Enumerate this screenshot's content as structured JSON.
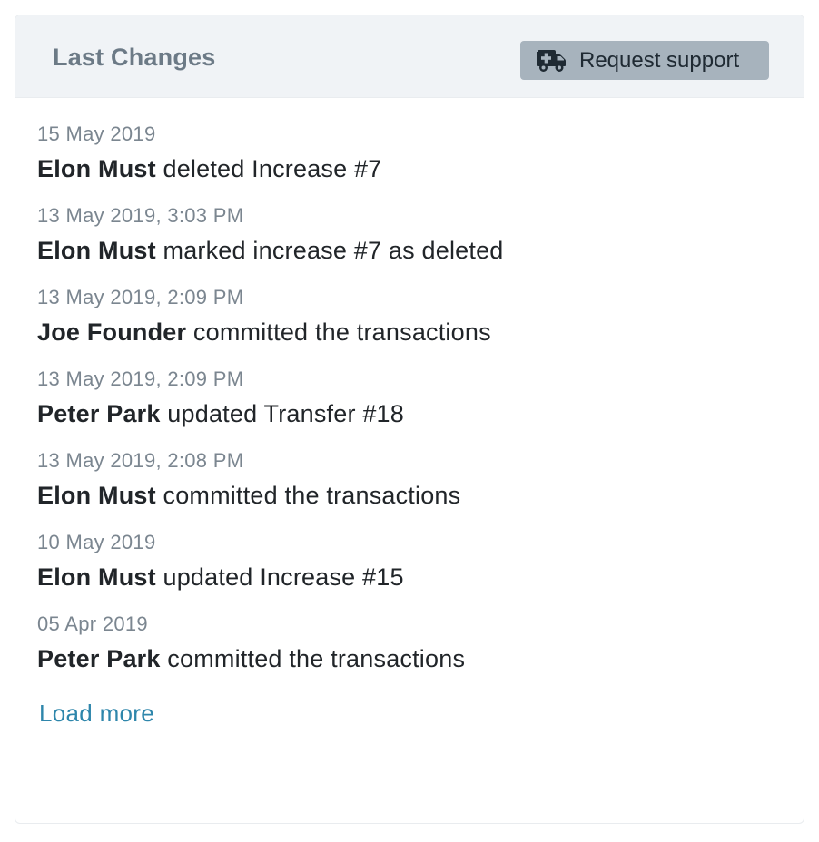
{
  "card": {
    "title": "Last Changes",
    "support_button": {
      "label": "Request support",
      "icon": "ambulance-icon"
    }
  },
  "changes": [
    {
      "date": "15 May 2019",
      "actor": "Elon Must",
      "action": "deleted Increase #7"
    },
    {
      "date": "13 May 2019, 3:03 PM",
      "actor": "Elon Must",
      "action": "marked increase #7 as deleted"
    },
    {
      "date": "13 May 2019, 2:09 PM",
      "actor": "Joe Founder",
      "action": "committed the transactions"
    },
    {
      "date": "13 May 2019, 2:09 PM",
      "actor": "Peter Park",
      "action": "updated Transfer #18"
    },
    {
      "date": "13 May 2019, 2:08 PM",
      "actor": "Elon Must",
      "action": "committed the transactions"
    },
    {
      "date": "10 May 2019",
      "actor": "Elon Must",
      "action": "updated Increase #15"
    },
    {
      "date": "05 Apr 2019",
      "actor": "Peter Park",
      "action": "committed the transactions"
    }
  ],
  "load_more": {
    "label": "Load more"
  },
  "colors": {
    "header_bg": "#f0f3f6",
    "title": "#6c7a86",
    "button_bg": "#a7b3bd",
    "date_text": "#7b8690",
    "body_text": "#212529",
    "link": "#2e86ab"
  }
}
